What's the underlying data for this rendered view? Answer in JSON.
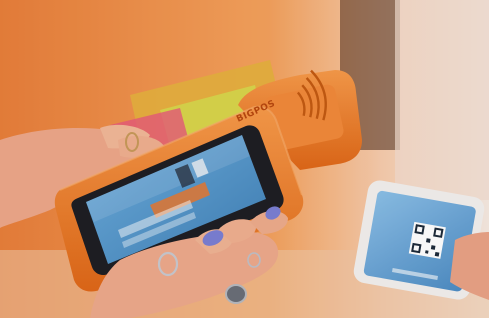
{
  "photo": {
    "brand_text": "BIGPOS",
    "palette": {
      "background_orange": "#f08a3c",
      "terminal_orange": "#f07e25",
      "terminal_screen": "#5a9bd0",
      "phone_screen": "#6fa8d8",
      "skin": "#f0b8a0",
      "nail_polish": "#7b7fd4"
    },
    "icons": [
      "contactless-payment-icon",
      "qr-code-icon",
      "fingerprint-ring"
    ]
  }
}
